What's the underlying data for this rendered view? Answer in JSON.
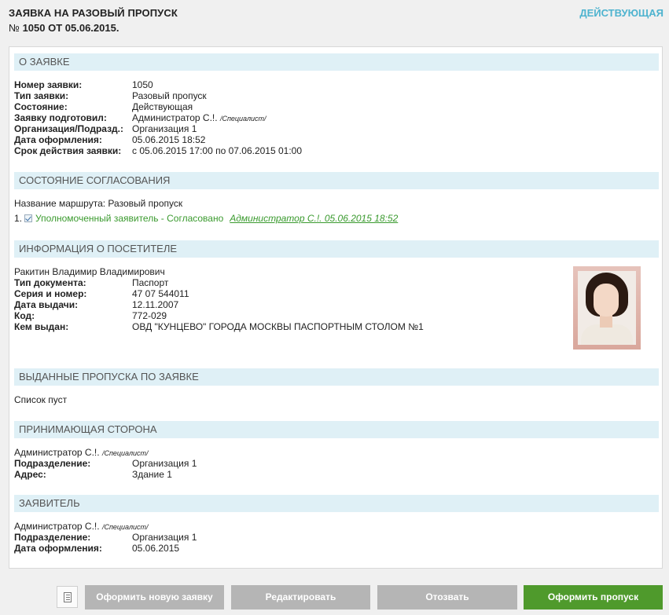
{
  "header": {
    "title": "ЗАЯВКА НА РАЗОВЫЙ ПРОПУСК",
    "number_prefix": "№",
    "number_text": "1050 ОТ 05.06.2015.",
    "status_link": "ДЕЙСТВУЮЩАЯ"
  },
  "about": {
    "heading": "О ЗАЯВКЕ",
    "rows": [
      {
        "label": "Номер заявки:",
        "value": "1050"
      },
      {
        "label": "Тип заявки:",
        "value": "Разовый пропуск"
      },
      {
        "label": "Состояние:",
        "value": "Действующая"
      },
      {
        "label": "Заявку подготовил:",
        "value": "Администратор С.!.",
        "note": "/Специалист/"
      },
      {
        "label": "Организация/Подразд.:",
        "value": "Организация 1"
      },
      {
        "label": "Дата оформления:",
        "value": "05.06.2015 18:52"
      },
      {
        "label": "Срок действия заявки:",
        "value": "с 05.06.2015 17:00 по 07.06.2015 01:00"
      }
    ]
  },
  "approval": {
    "heading": "СОСТОЯНИЕ СОГЛАСОВАНИЯ",
    "route": "Название маршрута: Разовый пропуск",
    "item_index": "1.",
    "item_text": "Уполномоченный заявитель - Согласовано",
    "item_approver": "Администратор С.!. 05.06.2015 18:52"
  },
  "visitor": {
    "heading": "ИНФОРМАЦИЯ О ПОСЕТИТЕЛЕ",
    "name": "Ракитин Владимир Владимирович",
    "rows": [
      {
        "label": "Тип документа:",
        "value": "Паспорт"
      },
      {
        "label": "Серия и номер:",
        "value": "47 07 544011"
      },
      {
        "label": "Дата выдачи:",
        "value": "12.11.2007"
      },
      {
        "label": "Код:",
        "value": "772-029"
      },
      {
        "label": "Кем выдан:",
        "value": "ОВД \"КУНЦЕВО\" ГОРОДА МОСКВЫ ПАСПОРТНЫМ СТОЛОМ №1"
      }
    ]
  },
  "passes": {
    "heading": "ВЫДАННЫЕ ПРОПУСКА ПО ЗАЯВКЕ",
    "empty_text": "Список пуст"
  },
  "host": {
    "heading": "ПРИНИМАЮЩАЯ СТОРОНА",
    "name": "Администратор С.!.",
    "note": "/Специалист/",
    "rows": [
      {
        "label": "Подразделение:",
        "value": "Организация 1"
      },
      {
        "label": "Адрес:",
        "value": "Здание 1"
      }
    ]
  },
  "applicant": {
    "heading": "ЗАЯВИТЕЛЬ",
    "name": "Администратор С.!.",
    "note": "/Специалист/",
    "rows": [
      {
        "label": "Подразделение:",
        "value": "Организация 1"
      },
      {
        "label": "Дата оформления:",
        "value": "05.06.2015"
      }
    ]
  },
  "actions": {
    "icon": "document-icon",
    "new_request": "Оформить новую заявку",
    "edit": "Редактировать",
    "revoke": "Отозвать",
    "issue_pass": "Оформить пропуск"
  },
  "colors": {
    "status_link": "#4eb3cf",
    "section_bg": "#dff0f6",
    "approved_green": "#3a9a2e",
    "primary_button": "#4f9a2c",
    "secondary_button": "#b5b5b5"
  }
}
